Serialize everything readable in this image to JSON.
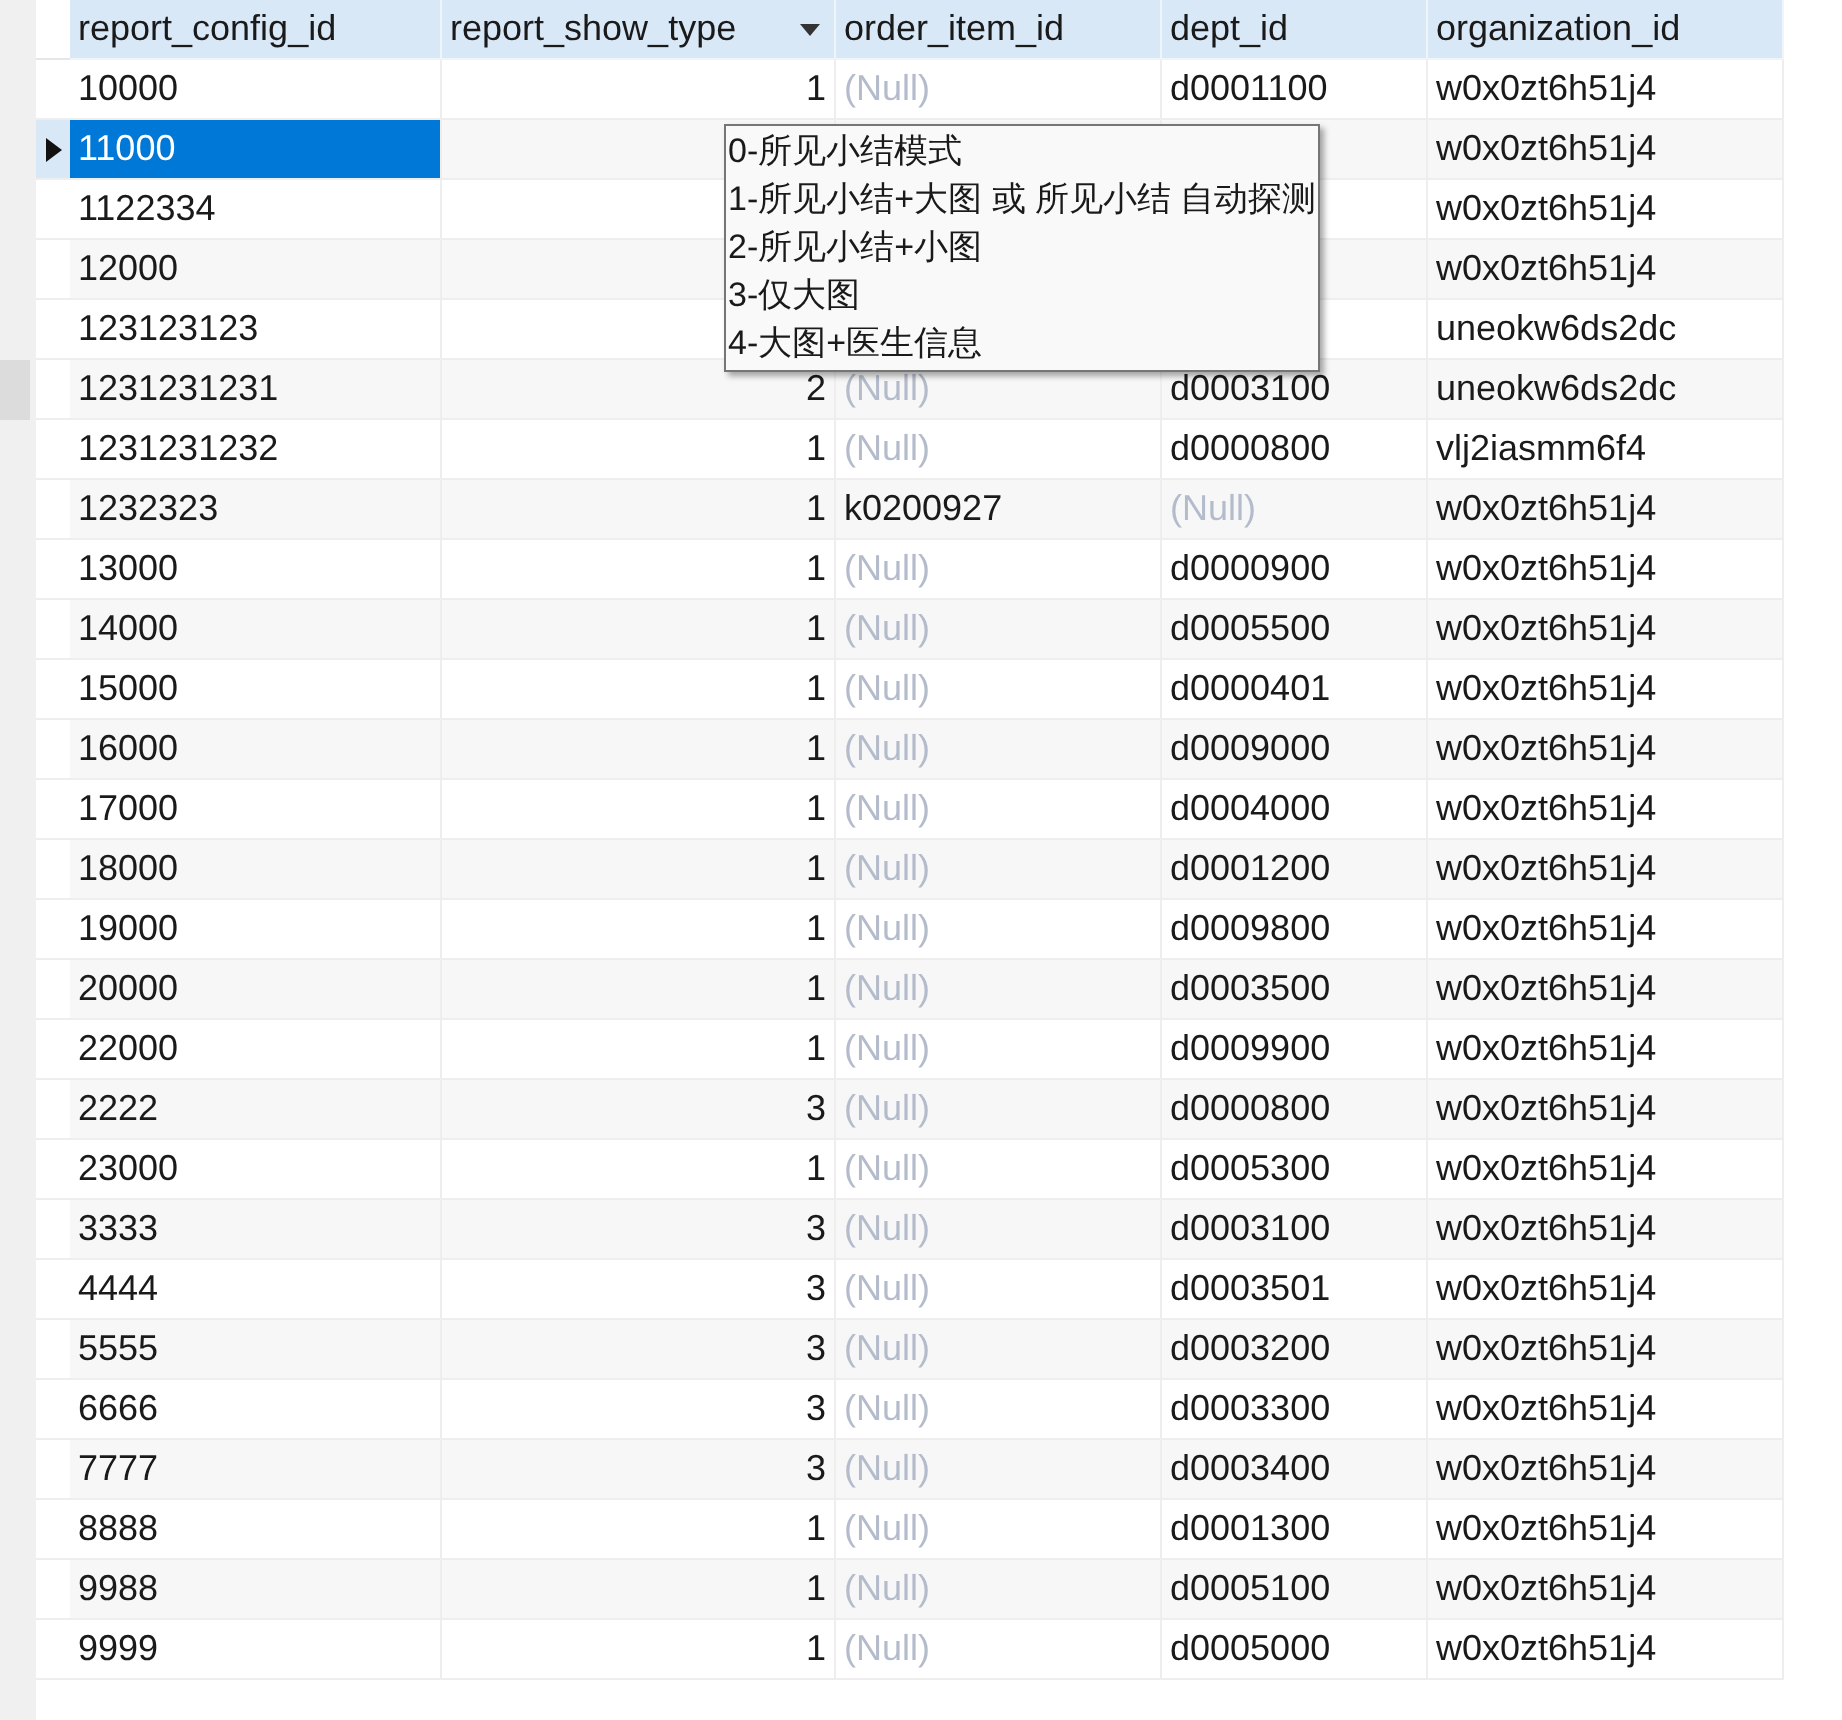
{
  "table": {
    "columns": [
      {
        "label": "report_config_id",
        "sort_arrow": false
      },
      {
        "label": "report_show_type",
        "sort_arrow": true
      },
      {
        "label": "order_item_id",
        "sort_arrow": false
      },
      {
        "label": "dept_id",
        "sort_arrow": false
      },
      {
        "label": "organization_id",
        "sort_arrow": false
      }
    ],
    "rows": [
      {
        "selected": false,
        "cells": [
          "10000",
          "1",
          {
            "text": "(Null)",
            "is_null": true
          },
          "d0001100",
          "w0x0zt6h51j4"
        ]
      },
      {
        "selected": true,
        "cells": [
          "11000",
          null,
          null,
          null,
          "w0x0zt6h51j4"
        ]
      },
      {
        "selected": false,
        "cells": [
          "1122334",
          null,
          null,
          null,
          "w0x0zt6h51j4"
        ]
      },
      {
        "selected": false,
        "cells": [
          "12000",
          null,
          null,
          null,
          "w0x0zt6h51j4"
        ]
      },
      {
        "selected": false,
        "cells": [
          "123123123",
          null,
          null,
          null,
          "uneokw6ds2dc"
        ]
      },
      {
        "selected": false,
        "cells": [
          "1231231231",
          "2",
          {
            "text": "(Null)",
            "is_null": true
          },
          "d0003100",
          "uneokw6ds2dc"
        ]
      },
      {
        "selected": false,
        "cells": [
          "1231231232",
          "1",
          {
            "text": "(Null)",
            "is_null": true
          },
          "d0000800",
          "vlj2iasmm6f4"
        ]
      },
      {
        "selected": false,
        "cells": [
          "1232323",
          "1",
          "k0200927",
          {
            "text": "(Null)",
            "is_null": true
          },
          "w0x0zt6h51j4"
        ]
      },
      {
        "selected": false,
        "cells": [
          "13000",
          "1",
          {
            "text": "(Null)",
            "is_null": true
          },
          "d0000900",
          "w0x0zt6h51j4"
        ]
      },
      {
        "selected": false,
        "cells": [
          "14000",
          "1",
          {
            "text": "(Null)",
            "is_null": true
          },
          "d0005500",
          "w0x0zt6h51j4"
        ]
      },
      {
        "selected": false,
        "cells": [
          "15000",
          "1",
          {
            "text": "(Null)",
            "is_null": true
          },
          "d0000401",
          "w0x0zt6h51j4"
        ]
      },
      {
        "selected": false,
        "cells": [
          "16000",
          "1",
          {
            "text": "(Null)",
            "is_null": true
          },
          "d0009000",
          "w0x0zt6h51j4"
        ]
      },
      {
        "selected": false,
        "cells": [
          "17000",
          "1",
          {
            "text": "(Null)",
            "is_null": true
          },
          "d0004000",
          "w0x0zt6h51j4"
        ]
      },
      {
        "selected": false,
        "cells": [
          "18000",
          "1",
          {
            "text": "(Null)",
            "is_null": true
          },
          "d0001200",
          "w0x0zt6h51j4"
        ]
      },
      {
        "selected": false,
        "cells": [
          "19000",
          "1",
          {
            "text": "(Null)",
            "is_null": true
          },
          "d0009800",
          "w0x0zt6h51j4"
        ]
      },
      {
        "selected": false,
        "cells": [
          "20000",
          "1",
          {
            "text": "(Null)",
            "is_null": true
          },
          "d0003500",
          "w0x0zt6h51j4"
        ]
      },
      {
        "selected": false,
        "cells": [
          "22000",
          "1",
          {
            "text": "(Null)",
            "is_null": true
          },
          "d0009900",
          "w0x0zt6h51j4"
        ]
      },
      {
        "selected": false,
        "cells": [
          "2222",
          "3",
          {
            "text": "(Null)",
            "is_null": true
          },
          "d0000800",
          "w0x0zt6h51j4"
        ]
      },
      {
        "selected": false,
        "cells": [
          "23000",
          "1",
          {
            "text": "(Null)",
            "is_null": true
          },
          "d0005300",
          "w0x0zt6h51j4"
        ]
      },
      {
        "selected": false,
        "cells": [
          "3333",
          "3",
          {
            "text": "(Null)",
            "is_null": true
          },
          "d0003100",
          "w0x0zt6h51j4"
        ]
      },
      {
        "selected": false,
        "cells": [
          "4444",
          "3",
          {
            "text": "(Null)",
            "is_null": true
          },
          "d0003501",
          "w0x0zt6h51j4"
        ]
      },
      {
        "selected": false,
        "cells": [
          "5555",
          "3",
          {
            "text": "(Null)",
            "is_null": true
          },
          "d0003200",
          "w0x0zt6h51j4"
        ]
      },
      {
        "selected": false,
        "cells": [
          "6666",
          "3",
          {
            "text": "(Null)",
            "is_null": true
          },
          "d0003300",
          "w0x0zt6h51j4"
        ]
      },
      {
        "selected": false,
        "cells": [
          "7777",
          "3",
          {
            "text": "(Null)",
            "is_null": true
          },
          "d0003400",
          "w0x0zt6h51j4"
        ]
      },
      {
        "selected": false,
        "cells": [
          "8888",
          "1",
          {
            "text": "(Null)",
            "is_null": true
          },
          "d0001300",
          "w0x0zt6h51j4"
        ]
      },
      {
        "selected": false,
        "cells": [
          "9988",
          "1",
          {
            "text": "(Null)",
            "is_null": true
          },
          "d0005100",
          "w0x0zt6h51j4"
        ]
      },
      {
        "selected": false,
        "cells": [
          "9999",
          "1",
          {
            "text": "(Null)",
            "is_null": true
          },
          "d0005000",
          "w0x0zt6h51j4"
        ]
      }
    ]
  },
  "tooltip": {
    "lines": [
      "0-所见小结模式",
      "1-所见小结+大图 或 所见小结 自动探测",
      "2-所见小结+小图",
      "3-仅大图",
      "4-大图+医生信息"
    ]
  }
}
